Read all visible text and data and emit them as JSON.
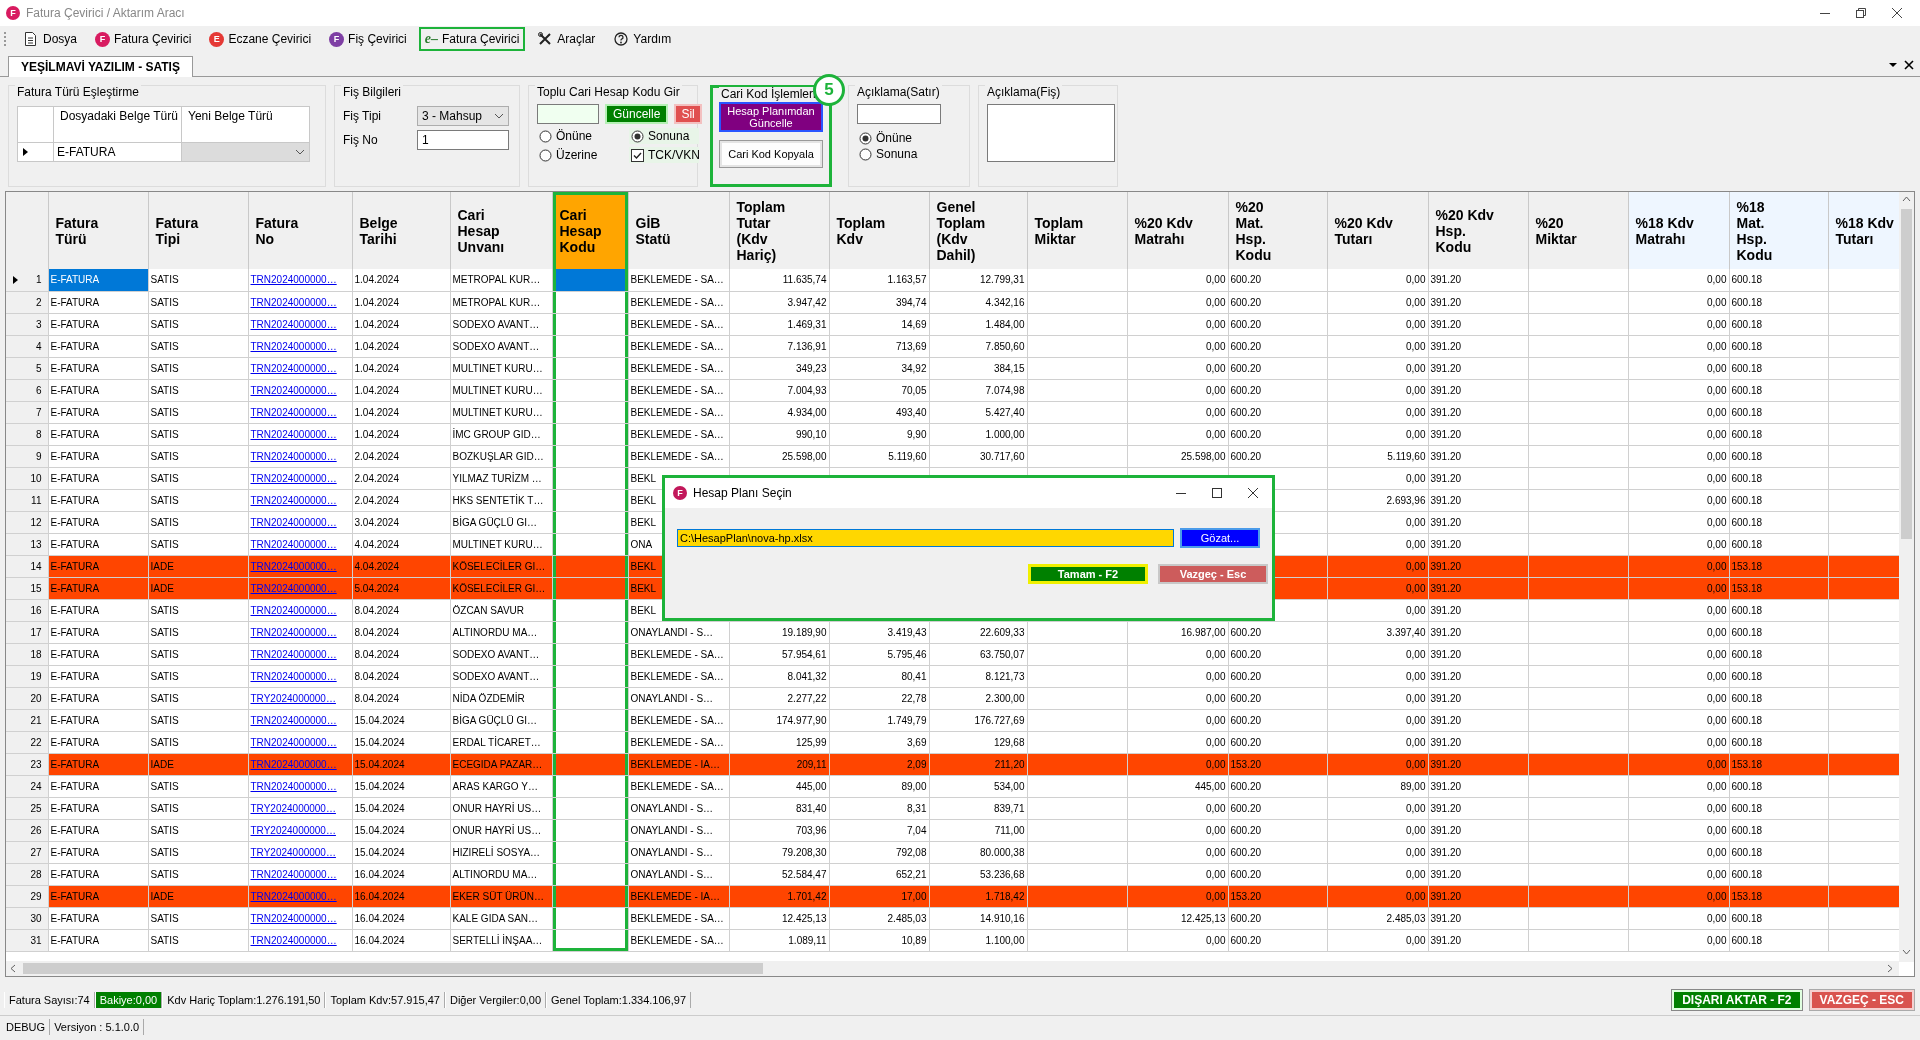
{
  "window": {
    "title": "Fatura Çevirici / Aktarım Aracı",
    "icon_letter": "F",
    "menu": [
      {
        "label": "Dosya",
        "kind": "icon",
        "selected": false
      },
      {
        "label": "Fatura Çevirici",
        "kind": "badge",
        "badge": "F",
        "color": "#d81b60",
        "selected": false
      },
      {
        "label": "Eczane Çevirici",
        "kind": "badge",
        "badge": "E",
        "color": "#e53935",
        "selected": false
      },
      {
        "label": "Fiş Çevirici",
        "kind": "badge",
        "badge": "F",
        "color": "#7e3fa4",
        "selected": false
      },
      {
        "label": "Fatura Çevirici",
        "kind": "script",
        "badge": "e–",
        "color": "#2e7d32",
        "selected": true
      },
      {
        "label": "Araçlar",
        "kind": "icon",
        "selected": false
      },
      {
        "label": "Yardım",
        "kind": "icon",
        "selected": false
      }
    ]
  },
  "document_tab": {
    "label": "YEŞİLMAVİ YAZILIM - SATIŞ",
    "selected": true
  },
  "filters": {
    "type_mapping": {
      "title": "Fatura Türü Eşleştirme",
      "columns": [
        "Dosyadaki Belge Türü",
        "Yeni Belge Türü"
      ],
      "rows": [
        {
          "source": "E-FATURA",
          "target_disabled": true
        }
      ]
    },
    "slip_info": {
      "title": "Fiş Bilgileri",
      "fields": [
        {
          "label": "Fiş Tipi",
          "kind": "combo",
          "value": "3 - Mahsup"
        },
        {
          "label": "Fiş No",
          "kind": "text",
          "value": "1"
        }
      ]
    },
    "bulk_code": {
      "title": "Toplu Cari Hesap Kodu Gir",
      "buttons": [
        {
          "label": "Güncelle",
          "kind": "confirm"
        },
        {
          "label": "Sil",
          "kind": "delete"
        }
      ],
      "options": [
        {
          "label": "Önüne",
          "selected": false
        },
        {
          "label": "Sonuna",
          "selected": true
        },
        {
          "label": "Üzerine",
          "selected": false
        }
      ],
      "checkbox": {
        "label": "TCK/VKN",
        "checked": true
      }
    },
    "code_actions": {
      "title": "Cari Kod İşlemleri",
      "highlighted": true,
      "badge": "5",
      "buttons": [
        {
          "label": "Hesap Planımdan Güncelle",
          "kind": "primary"
        },
        {
          "label": "Cari Kod Kopyala",
          "kind": "normal"
        }
      ]
    },
    "line_note": {
      "title": "Açıklama(Satır)",
      "options": [
        {
          "label": "Önüne",
          "selected": true
        },
        {
          "label": "Sonuna",
          "selected": false
        }
      ]
    },
    "slip_note": {
      "title": "Açıklama(Fiş)"
    }
  },
  "grid": {
    "columns": [
      {
        "label": "Fatura Türü",
        "kind": "text",
        "highlighted": false,
        "tinted": false
      },
      {
        "label": "Fatura Tipi",
        "kind": "text",
        "highlighted": false,
        "tinted": false
      },
      {
        "label": "Fatura No",
        "kind": "link",
        "highlighted": false,
        "tinted": false
      },
      {
        "label": "Belge Tarihi",
        "kind": "text",
        "highlighted": false,
        "tinted": false
      },
      {
        "label": "Cari Hesap Unvanı",
        "kind": "text",
        "highlighted": false,
        "tinted": false
      },
      {
        "label": "Cari Hesap Kodu",
        "kind": "text",
        "highlighted": true,
        "tinted": false
      },
      {
        "label": "GİB Statü",
        "kind": "text",
        "highlighted": false,
        "tinted": false
      },
      {
        "label": "Toplam Tutar (Kdv Hariç)",
        "kind": "number",
        "highlighted": false,
        "tinted": false
      },
      {
        "label": "Toplam Kdv",
        "kind": "number",
        "highlighted": false,
        "tinted": false
      },
      {
        "label": "Genel Toplam (Kdv Dahil)",
        "kind": "number",
        "highlighted": false,
        "tinted": false
      },
      {
        "label": "Toplam Miktar",
        "kind": "number",
        "highlighted": false,
        "tinted": false
      },
      {
        "label": "%20 Kdv Matrahı",
        "kind": "number",
        "highlighted": false,
        "tinted": false
      },
      {
        "label": "%20 Mat. Hsp. Kodu",
        "kind": "text",
        "highlighted": false,
        "tinted": false
      },
      {
        "label": "%20 Kdv Tutarı",
        "kind": "number",
        "highlighted": false,
        "tinted": false
      },
      {
        "label": "%20 Kdv Hsp. Kodu",
        "kind": "text",
        "highlighted": false,
        "tinted": false
      },
      {
        "label": "%20 Miktar",
        "kind": "number",
        "highlighted": false,
        "tinted": false
      },
      {
        "label": "%18 Kdv Matrahı",
        "kind": "number",
        "highlighted": false,
        "tinted": true
      },
      {
        "label": "%18 Mat. Hsp. Kodu",
        "kind": "text",
        "highlighted": false,
        "tinted": true
      },
      {
        "label": "%18 Kdv Tutarı",
        "kind": "number",
        "highlighted": false,
        "tinted": true
      }
    ],
    "rows": [
      {
        "number": "1",
        "selected": true,
        "highlighted": false,
        "cells": [
          "E-FATURA",
          "SATIS",
          "TRN2024000000…",
          "1.04.2024",
          "METROPAL KUR…",
          null,
          "BEKLEMEDE - SA…",
          "11.635,74",
          "1.163,57",
          "12.799,31",
          null,
          "0,00",
          "600.20",
          "0,00",
          "391.20",
          null,
          "0,00",
          "600.18"
        ]
      },
      {
        "number": "2",
        "selected": false,
        "highlighted": false,
        "cells": [
          "E-FATURA",
          "SATIS",
          "TRN2024000000…",
          "1.04.2024",
          "METROPAL KUR…",
          null,
          "BEKLEMEDE - SA…",
          "3.947,42",
          "394,74",
          "4.342,16",
          null,
          "0,00",
          "600.20",
          "0,00",
          "391.20",
          null,
          "0,00",
          "600.18"
        ]
      },
      {
        "number": "3",
        "selected": false,
        "highlighted": false,
        "cells": [
          "E-FATURA",
          "SATIS",
          "TRN2024000000…",
          "1.04.2024",
          "SODEXO AVANT…",
          null,
          "BEKLEMEDE - SA…",
          "1.469,31",
          "14,69",
          "1.484,00",
          null,
          "0,00",
          "600.20",
          "0,00",
          "391.20",
          null,
          "0,00",
          "600.18"
        ]
      },
      {
        "number": "4",
        "selected": false,
        "highlighted": false,
        "cells": [
          "E-FATURA",
          "SATIS",
          "TRN2024000000…",
          "1.04.2024",
          "SODEXO AVANT…",
          null,
          "BEKLEMEDE - SA…",
          "7.136,91",
          "713,69",
          "7.850,60",
          null,
          "0,00",
          "600.20",
          "0,00",
          "391.20",
          null,
          "0,00",
          "600.18"
        ]
      },
      {
        "number": "5",
        "selected": false,
        "highlighted": false,
        "cells": [
          "E-FATURA",
          "SATIS",
          "TRN2024000000…",
          "1.04.2024",
          "MULTINET KURU…",
          null,
          "BEKLEMEDE - SA…",
          "349,23",
          "34,92",
          "384,15",
          null,
          "0,00",
          "600.20",
          "0,00",
          "391.20",
          null,
          "0,00",
          "600.18"
        ]
      },
      {
        "number": "6",
        "selected": false,
        "highlighted": false,
        "cells": [
          "E-FATURA",
          "SATIS",
          "TRN2024000000…",
          "1.04.2024",
          "MULTINET KURU…",
          null,
          "BEKLEMEDE - SA…",
          "7.004,93",
          "70,05",
          "7.074,98",
          null,
          "0,00",
          "600.20",
          "0,00",
          "391.20",
          null,
          "0,00",
          "600.18"
        ]
      },
      {
        "number": "7",
        "selected": false,
        "highlighted": false,
        "cells": [
          "E-FATURA",
          "SATIS",
          "TRN2024000000…",
          "1.04.2024",
          "MULTINET KURU…",
          null,
          "BEKLEMEDE - SA…",
          "4.934,00",
          "493,40",
          "5.427,40",
          null,
          "0,00",
          "600.20",
          "0,00",
          "391.20",
          null,
          "0,00",
          "600.18"
        ]
      },
      {
        "number": "8",
        "selected": false,
        "highlighted": false,
        "cells": [
          "E-FATURA",
          "SATIS",
          "TRN2024000000…",
          "1.04.2024",
          "İMC GROUP GID…",
          null,
          "BEKLEMEDE - SA…",
          "990,10",
          "9,90",
          "1.000,00",
          null,
          "0,00",
          "600.20",
          "0,00",
          "391.20",
          null,
          "0,00",
          "600.18"
        ]
      },
      {
        "number": "9",
        "selected": false,
        "highlighted": false,
        "cells": [
          "E-FATURA",
          "SATIS",
          "TRN2024000000…",
          "2.04.2024",
          "BOZKUŞLAR GID…",
          null,
          "BEKLEMEDE - SA…",
          "25.598,00",
          "5.119,60",
          "30.717,60",
          null,
          "25.598,00",
          "600.20",
          "5.119,60",
          "391.20",
          null,
          "0,00",
          "600.18"
        ]
      },
      {
        "number": "10",
        "selected": false,
        "highlighted": false,
        "cells": [
          "E-FATURA",
          "SATIS",
          "TRN2024000000…",
          "2.04.2024",
          "YILMAZ TURİZM …",
          null,
          "BEKL",
          null,
          null,
          null,
          null,
          null,
          null,
          "0,00",
          "391.20",
          null,
          "0,00",
          "600.18"
        ]
      },
      {
        "number": "11",
        "selected": false,
        "highlighted": false,
        "cells": [
          "E-FATURA",
          "SATIS",
          "TRN2024000000…",
          "2.04.2024",
          "HKS SENTETİK T…",
          null,
          "BEKL",
          null,
          null,
          null,
          null,
          null,
          null,
          "2.693,96",
          "391.20",
          null,
          "0,00",
          "600.18"
        ]
      },
      {
        "number": "12",
        "selected": false,
        "highlighted": false,
        "cells": [
          "E-FATURA",
          "SATIS",
          "TRN2024000000…",
          "3.04.2024",
          "BİGA GÜÇLÜ GI…",
          null,
          "BEKL",
          null,
          null,
          null,
          null,
          null,
          null,
          "0,00",
          "391.20",
          null,
          "0,00",
          "600.18"
        ]
      },
      {
        "number": "13",
        "selected": false,
        "highlighted": false,
        "cells": [
          "E-FATURA",
          "SATIS",
          "TRN2024000000…",
          "4.04.2024",
          "MULTINET KURU…",
          null,
          "ONA",
          null,
          null,
          null,
          null,
          null,
          null,
          "0,00",
          "391.20",
          null,
          "0,00",
          "600.18"
        ]
      },
      {
        "number": "14",
        "selected": false,
        "highlighted": true,
        "cells": [
          "E-FATURA",
          "IADE",
          "TRN2024000000…",
          "4.04.2024",
          "KÖSELECİLER GI…",
          null,
          "BEKL",
          null,
          null,
          null,
          null,
          null,
          null,
          "0,00",
          "391.20",
          null,
          "0,00",
          "153.18"
        ]
      },
      {
        "number": "15",
        "selected": false,
        "highlighted": true,
        "cells": [
          "E-FATURA",
          "IADE",
          "TRN2024000000…",
          "5.04.2024",
          "KÖSELECİLER GI…",
          null,
          "BEKL",
          null,
          null,
          null,
          null,
          null,
          null,
          "0,00",
          "391.20",
          null,
          "0,00",
          "153.18"
        ]
      },
      {
        "number": "16",
        "selected": false,
        "highlighted": false,
        "cells": [
          "E-FATURA",
          "SATIS",
          "TRN2024000000…",
          "8.04.2024",
          "ÖZCAN SAVUR",
          null,
          "BEKL",
          null,
          null,
          null,
          null,
          null,
          null,
          "0,00",
          "391.20",
          null,
          "0,00",
          "600.18"
        ]
      },
      {
        "number": "17",
        "selected": false,
        "highlighted": false,
        "cells": [
          "E-FATURA",
          "SATIS",
          "TRN2024000000…",
          "8.04.2024",
          "ALTINORDU MA…",
          null,
          "ONAYLANDI - S…",
          "19.189,90",
          "3.419,43",
          "22.609,33",
          null,
          "16.987,00",
          "600.20",
          "3.397,40",
          "391.20",
          null,
          "0,00",
          "600.18"
        ]
      },
      {
        "number": "18",
        "selected": false,
        "highlighted": false,
        "cells": [
          "E-FATURA",
          "SATIS",
          "TRN2024000000…",
          "8.04.2024",
          "SODEXO AVANT…",
          null,
          "BEKLEMEDE - SA…",
          "57.954,61",
          "5.795,46",
          "63.750,07",
          null,
          "0,00",
          "600.20",
          "0,00",
          "391.20",
          null,
          "0,00",
          "600.18"
        ]
      },
      {
        "number": "19",
        "selected": false,
        "highlighted": false,
        "cells": [
          "E-FATURA",
          "SATIS",
          "TRN2024000000…",
          "8.04.2024",
          "SODEXO AVANT…",
          null,
          "BEKLEMEDE - SA…",
          "8.041,32",
          "80,41",
          "8.121,73",
          null,
          "0,00",
          "600.20",
          "0,00",
          "391.20",
          null,
          "0,00",
          "600.18"
        ]
      },
      {
        "number": "20",
        "selected": false,
        "highlighted": false,
        "cells": [
          "E-FATURA",
          "SATIS",
          "TRY2024000000…",
          "8.04.2024",
          "NİDA ÖZDEMİR",
          null,
          "ONAYLANDI - S…",
          "2.277,22",
          "22,78",
          "2.300,00",
          null,
          "0,00",
          "600.20",
          "0,00",
          "391.20",
          null,
          "0,00",
          "600.18"
        ]
      },
      {
        "number": "21",
        "selected": false,
        "highlighted": false,
        "cells": [
          "E-FATURA",
          "SATIS",
          "TRN2024000000…",
          "15.04.2024",
          "BİGA GÜÇLÜ GI…",
          null,
          "BEKLEMEDE - SA…",
          "174.977,90",
          "1.749,79",
          "176.727,69",
          null,
          "0,00",
          "600.20",
          "0,00",
          "391.20",
          null,
          "0,00",
          "600.18"
        ]
      },
      {
        "number": "22",
        "selected": false,
        "highlighted": false,
        "cells": [
          "E-FATURA",
          "SATIS",
          "TRN2024000000…",
          "15.04.2024",
          "ERDAL TİCARET…",
          null,
          "BEKLEMEDE - SA…",
          "125,99",
          "3,69",
          "129,68",
          null,
          "0,00",
          "600.20",
          "0,00",
          "391.20",
          null,
          "0,00",
          "600.18"
        ]
      },
      {
        "number": "23",
        "selected": false,
        "highlighted": true,
        "cells": [
          "E-FATURA",
          "IADE",
          "TRN2024000000…",
          "15.04.2024",
          "ECEGIDA PAZAR…",
          null,
          "BEKLEMEDE - IA…",
          "209,11",
          "2,09",
          "211,20",
          null,
          "0,00",
          "153.20",
          "0,00",
          "391.20",
          null,
          "0,00",
          "153.18"
        ]
      },
      {
        "number": "24",
        "selected": false,
        "highlighted": false,
        "cells": [
          "E-FATURA",
          "SATIS",
          "TRN2024000000…",
          "15.04.2024",
          "ARAS KARGO Y…",
          null,
          "BEKLEMEDE - SA…",
          "445,00",
          "89,00",
          "534,00",
          null,
          "445,00",
          "600.20",
          "89,00",
          "391.20",
          null,
          "0,00",
          "600.18"
        ]
      },
      {
        "number": "25",
        "selected": false,
        "highlighted": false,
        "cells": [
          "E-FATURA",
          "SATIS",
          "TRY2024000000…",
          "15.04.2024",
          "ONUR HAYRİ US…",
          null,
          "ONAYLANDI - S…",
          "831,40",
          "8,31",
          "839,71",
          null,
          "0,00",
          "600.20",
          "0,00",
          "391.20",
          null,
          "0,00",
          "600.18"
        ]
      },
      {
        "number": "26",
        "selected": false,
        "highlighted": false,
        "cells": [
          "E-FATURA",
          "SATIS",
          "TRY2024000000…",
          "15.04.2024",
          "ONUR HAYRİ US…",
          null,
          "ONAYLANDI - S…",
          "703,96",
          "7,04",
          "711,00",
          null,
          "0,00",
          "600.20",
          "0,00",
          "391.20",
          null,
          "0,00",
          "600.18"
        ]
      },
      {
        "number": "27",
        "selected": false,
        "highlighted": false,
        "cells": [
          "E-FATURA",
          "SATIS",
          "TRY2024000000…",
          "15.04.2024",
          "HIZIRELİ SOSYA…",
          null,
          "ONAYLANDI - S…",
          "79.208,30",
          "792,08",
          "80.000,38",
          null,
          "0,00",
          "600.20",
          "0,00",
          "391.20",
          null,
          "0,00",
          "600.18"
        ]
      },
      {
        "number": "28",
        "selected": false,
        "highlighted": false,
        "cells": [
          "E-FATURA",
          "SATIS",
          "TRN2024000000…",
          "16.04.2024",
          "ALTINORDU MA…",
          null,
          "ONAYLANDI - S…",
          "52.584,47",
          "652,21",
          "53.236,68",
          null,
          "0,00",
          "600.20",
          "0,00",
          "391.20",
          null,
          "0,00",
          "600.18"
        ]
      },
      {
        "number": "29",
        "selected": false,
        "highlighted": true,
        "cells": [
          "E-FATURA",
          "IADE",
          "TRN2024000000…",
          "16.04.2024",
          "EKER SÜT ÜRÜN…",
          null,
          "BEKLEMEDE - IA…",
          "1.701,42",
          "17,00",
          "1.718,42",
          null,
          "0,00",
          "153.20",
          "0,00",
          "391.20",
          null,
          "0,00",
          "153.18"
        ]
      },
      {
        "number": "30",
        "selected": false,
        "highlighted": false,
        "cells": [
          "E-FATURA",
          "SATIS",
          "TRN2024000000…",
          "16.04.2024",
          "KALE GIDA SAN…",
          null,
          "BEKLEMEDE - SA…",
          "12.425,13",
          "2.485,03",
          "14.910,16",
          null,
          "12.425,13",
          "600.20",
          "2.485,03",
          "391.20",
          null,
          "0,00",
          "600.18"
        ]
      },
      {
        "number": "31",
        "selected": false,
        "highlighted": false,
        "cells": [
          "E-FATURA",
          "SATIS",
          "TRN2024000000…",
          "16.04.2024",
          "SERTELLİ İNŞAA…",
          null,
          "BEKLEMEDE - SA…",
          "1.089,11",
          "10,89",
          "1.100,00",
          null,
          "0,00",
          "600.20",
          "0,00",
          "391.20",
          null,
          "0,00",
          "600.18"
        ]
      }
    ]
  },
  "dialog": {
    "title": "Hesap Planı Seçin",
    "icon_letter": "F",
    "highlighted": true,
    "path": "C:\\HesapPlan\\nova-hp.xlsx",
    "buttons": [
      {
        "label": "Gözat...",
        "kind": "browse"
      },
      {
        "label": "Tamam - F2",
        "kind": "confirm"
      },
      {
        "label": "Vazgeç - Esc",
        "kind": "cancel"
      }
    ]
  },
  "status_bar": {
    "items": [
      {
        "text": "Fatura Sayısı:74",
        "highlighted": false
      },
      {
        "text": "Bakiye:0,00",
        "highlighted": true
      },
      {
        "text": "Kdv Hariç Toplam:1.276.191,50",
        "highlighted": false
      },
      {
        "text": "Toplam Kdv:57.915,47",
        "highlighted": false
      },
      {
        "text": "Diğer Vergiler:0,00",
        "highlighted": false
      },
      {
        "text": "Genel Toplam:1.334.106,97",
        "highlighted": false
      }
    ],
    "buttons": [
      {
        "label": "DIŞARI AKTAR - F2",
        "kind": "confirm"
      },
      {
        "label": "VAZGEÇ - ESC",
        "kind": "cancel"
      }
    ]
  },
  "footer": {
    "items": [
      "DEBUG",
      "Versiyon : 5.1.0.0"
    ]
  }
}
